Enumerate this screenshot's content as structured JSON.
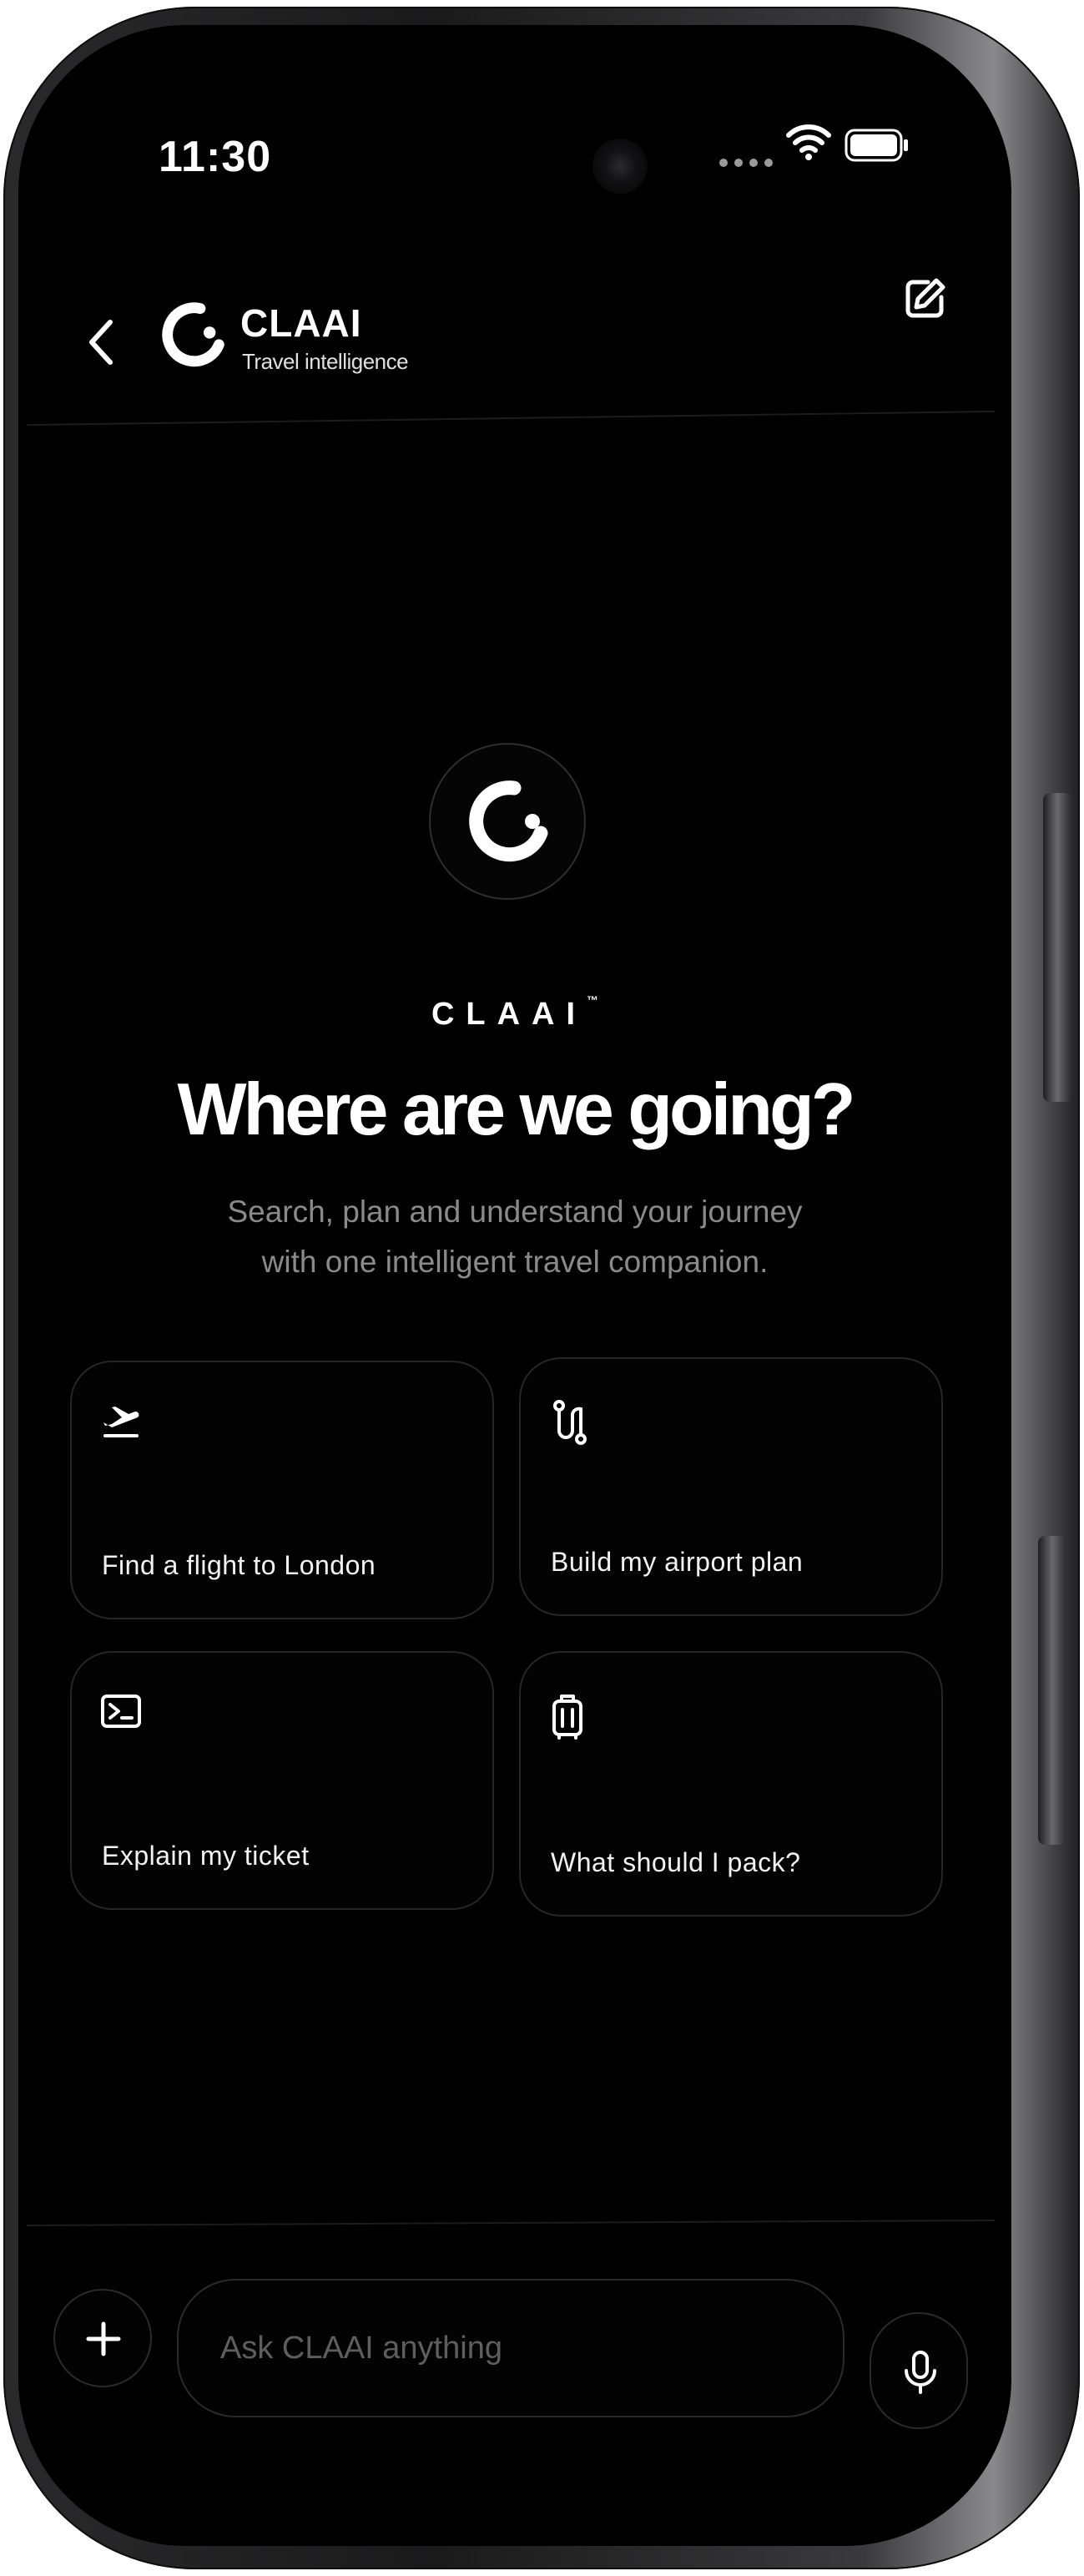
{
  "status_bar": {
    "time": "11:30"
  },
  "header": {
    "title": "CLAAI",
    "subtitle": "Travel intelligence"
  },
  "hero": {
    "wordmark": "CLAAI",
    "trademark": "™",
    "title": "Where are we going?",
    "subtitle_line1": "Search, plan and understand your journey",
    "subtitle_line2": "with one intelligent travel companion."
  },
  "suggestions": [
    {
      "label": "Find a flight to London",
      "icon": "plane-takeoff-icon"
    },
    {
      "label": "Build my airport plan",
      "icon": "route-icon"
    },
    {
      "label": "Explain my ticket",
      "icon": "ticket-icon"
    },
    {
      "label": "What should I pack?",
      "icon": "luggage-icon"
    }
  ],
  "composer": {
    "placeholder": "Ask CLAAI anything"
  },
  "colors": {
    "background": "#000000",
    "text": "#ffffff",
    "muted_text": "#8a8a8a",
    "card_border": "#262626"
  }
}
